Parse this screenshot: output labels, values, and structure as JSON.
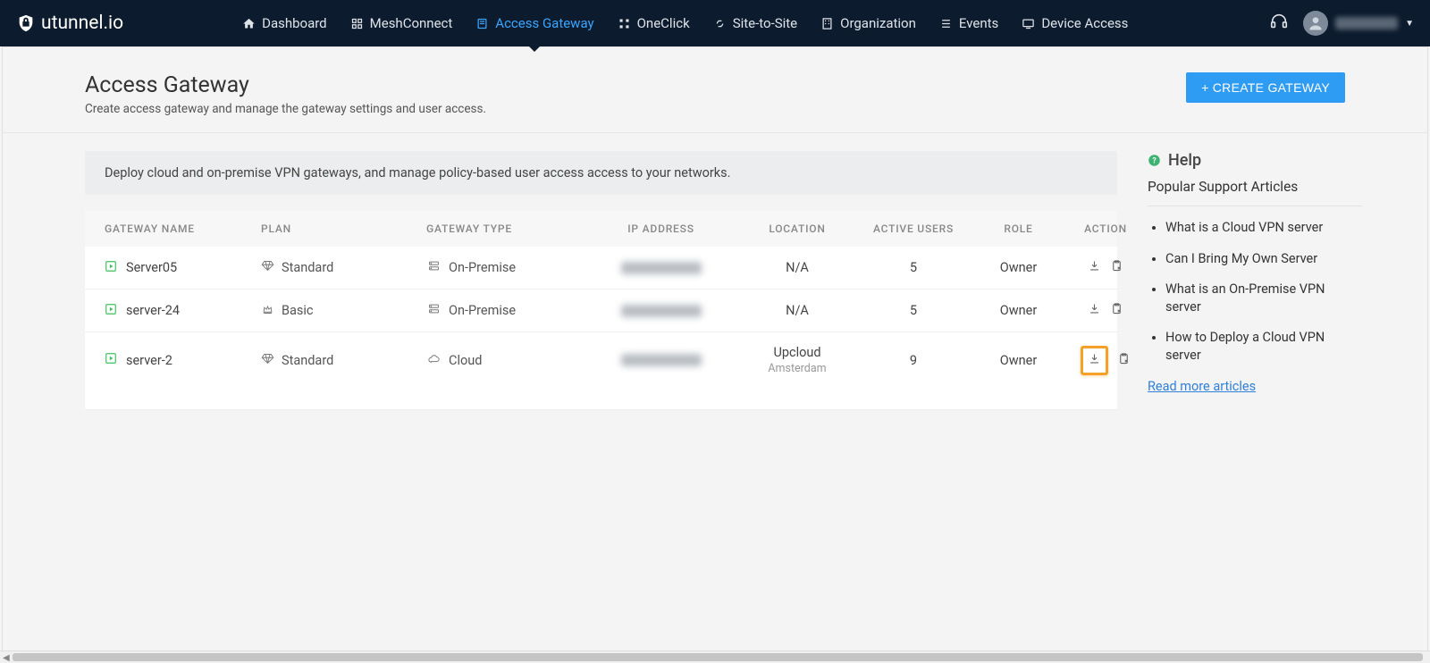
{
  "brand": "utunnel.io",
  "nav": {
    "dashboard": "Dashboard",
    "meshconnect": "MeshConnect",
    "accessgateway": "Access Gateway",
    "oneclick": "OneClick",
    "sitetosite": "Site-to-Site",
    "organization": "Organization",
    "events": "Events",
    "deviceaccess": "Device Access"
  },
  "header": {
    "title": "Access Gateway",
    "subtitle": "Create access gateway and manage the gateway settings and user access.",
    "create_btn": "+ CREATE GATEWAY"
  },
  "banner": "Deploy cloud and on-premise VPN gateways, and manage policy-based user access access to your networks.",
  "columns": {
    "c0": "GATEWAY NAME",
    "c1": "PLAN",
    "c2": "GATEWAY TYPE",
    "c3": "IP ADDRESS",
    "c4": "LOCATION",
    "c5": "ACTIVE USERS",
    "c6": "ROLE",
    "c7": "ACTION"
  },
  "rows": [
    {
      "name": "Server05",
      "plan": "Standard",
      "plan_icon": "diamond",
      "type": "On-Premise",
      "type_icon": "server",
      "location": "N/A",
      "location_sub": "",
      "users": "5",
      "role": "Owner",
      "highlight_dl": false
    },
    {
      "name": "server-24",
      "plan": "Basic",
      "plan_icon": "trophy",
      "type": "On-Premise",
      "type_icon": "server",
      "location": "N/A",
      "location_sub": "",
      "users": "5",
      "role": "Owner",
      "highlight_dl": false
    },
    {
      "name": "server-2",
      "plan": "Standard",
      "plan_icon": "diamond",
      "type": "Cloud",
      "type_icon": "cloud",
      "location": "Upcloud",
      "location_sub": "Amsterdam",
      "users": "9",
      "role": "Owner",
      "highlight_dl": true
    }
  ],
  "help": {
    "title": "Help",
    "subtitle": "Popular Support Articles",
    "articles": [
      "What is a Cloud VPN server",
      "Can I Bring My Own Server",
      "What is an On-Premise VPN server",
      "How to Deploy a Cloud VPN server"
    ],
    "read_more": "Read more articles"
  }
}
